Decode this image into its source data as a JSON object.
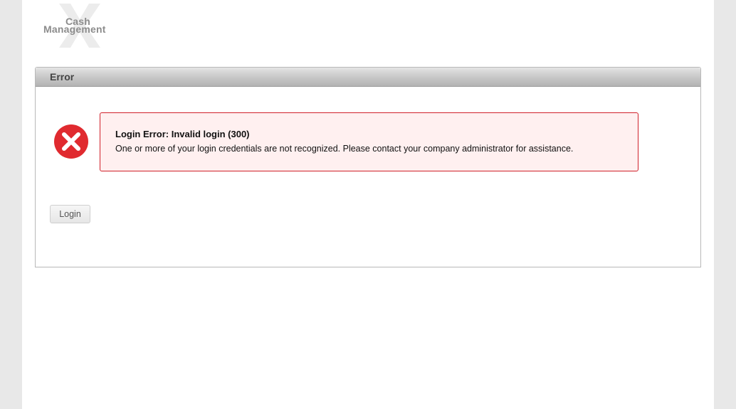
{
  "logo": {
    "line1": "Cash",
    "line2": "Management"
  },
  "panel": {
    "title": "Error"
  },
  "alert": {
    "title": "Login Error: Invalid login (300)",
    "message": "One or more of your login credentials are not recognized. Please contact your company administrator for assistance.",
    "icon": "error-x-icon"
  },
  "actions": {
    "login_label": "Login"
  },
  "colors": {
    "error_red": "#e02a2f",
    "alert_border": "#d0202a",
    "alert_background": "#fff0f0"
  }
}
